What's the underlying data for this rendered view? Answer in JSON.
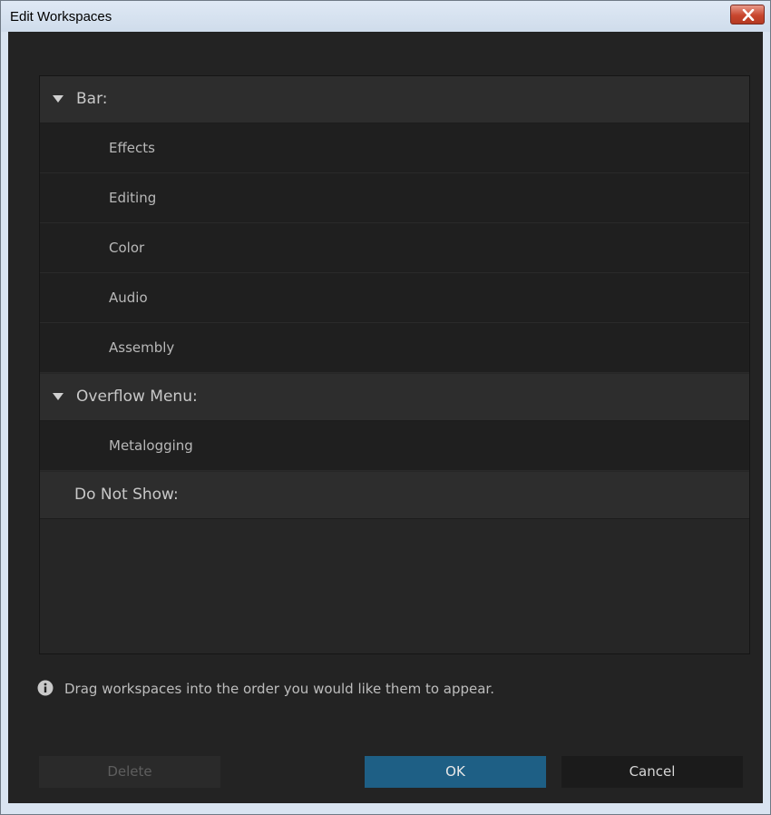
{
  "window": {
    "title": "Edit Workspaces"
  },
  "groups": {
    "bar": {
      "label": "Bar:",
      "items": [
        "Effects",
        "Editing",
        "Color",
        "Audio",
        "Assembly"
      ]
    },
    "overflow": {
      "label": "Overflow Menu:",
      "items": [
        "Metalogging"
      ]
    },
    "do_not_show": {
      "label": "Do Not Show:",
      "items": []
    }
  },
  "hint": {
    "icon": "info-icon",
    "text": "Drag workspaces into the order you would like them to appear."
  },
  "buttons": {
    "delete": "Delete",
    "ok": "OK",
    "cancel": "Cancel"
  },
  "colors": {
    "background": "#232323",
    "accent_ok": "#1e5f85",
    "close_button": "#c8462e"
  }
}
